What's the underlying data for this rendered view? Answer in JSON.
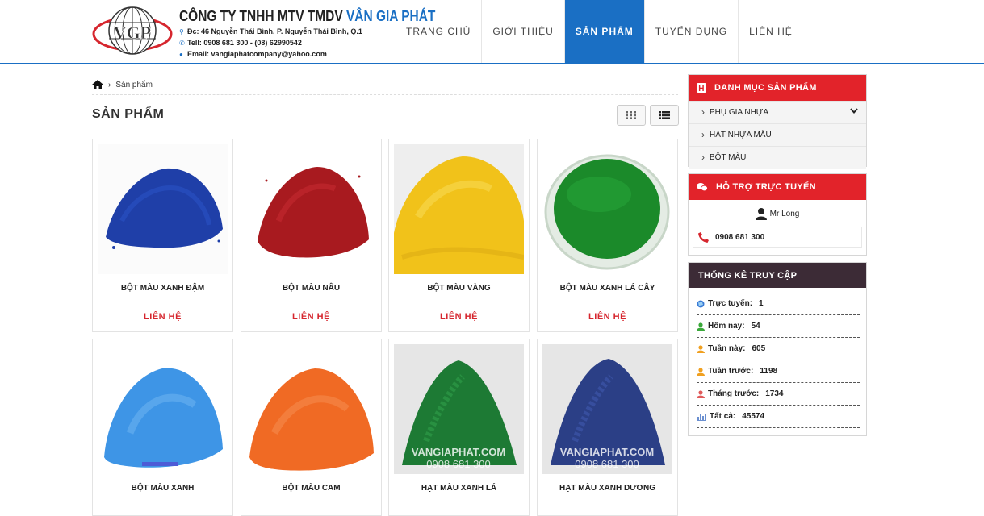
{
  "company": {
    "name_prefix": "CÔNG TY TNHH MTV TMDV ",
    "name_brand": "VÂN GIA PHÁT",
    "address": "Đc: 46 Nguyễn Thái Bình, P. Nguyễn Thái Bình, Q.1",
    "tel": "Tell: 0908 681 300 - (08) 62990542",
    "email": "Email: vangiaphatcompany@yahoo.com",
    "logo_text": "VGP"
  },
  "nav": {
    "items": [
      {
        "label": "TRANG CHỦ"
      },
      {
        "label": "GIỚI THIỆU"
      },
      {
        "label": "SẢN PHẨM"
      },
      {
        "label": "TUYỂN DỤNG"
      },
      {
        "label": "LIÊN HỆ"
      }
    ],
    "active": "SẢN PHẨM"
  },
  "breadcrumb": {
    "current": "Sản phẩm"
  },
  "page_title": "SẢN PHẨM",
  "products": [
    {
      "title": "BỘT MÀU XANH ĐẬM",
      "cta": "LIÊN HỆ",
      "color": "#1f3fa8"
    },
    {
      "title": "BỘT MÀU NÂU",
      "cta": "LIÊN HỆ",
      "color": "#a81a1f"
    },
    {
      "title": "BỘT MÀU VÀNG",
      "cta": "LIÊN HỆ",
      "color": "#f1c21a"
    },
    {
      "title": "BỘT MÀU XANH LÁ CÂY",
      "cta": "LIÊN HỆ",
      "color": "#1b8a2a"
    },
    {
      "title": "BỘT MÀU XANH",
      "color": "#3e95e6"
    },
    {
      "title": "BỘT MÀU CAM",
      "color": "#f06a24"
    },
    {
      "title": "HẠT MÀU XANH LÁ",
      "color": "#1d7a34",
      "watermark": "VANGIAPHAT.COM",
      "watermark_phone": "0908 681 300"
    },
    {
      "title": "HẠT MÀU XANH DƯƠNG",
      "color": "#2b3f86",
      "watermark": "VANGIAPHAT.COM",
      "watermark_phone": "0908 681 300"
    }
  ],
  "sidebar": {
    "categories": {
      "title": "DANH MỤC SẢN PHẨM",
      "items": [
        "PHỤ GIA NHỰA",
        "HẠT NHỰA MÀU",
        "BỘT MÀU"
      ]
    },
    "support": {
      "title": "HỖ TRỢ TRỰC TUYẾN",
      "name": "Mr Long",
      "phone": "0908 681 300"
    },
    "stats": {
      "title": "THỐNG KÊ TRUY CẬP",
      "rows": [
        {
          "label": "Trực tuyến:",
          "value": "1",
          "icon": "globe-icon"
        },
        {
          "label": "Hôm nay:",
          "value": "54",
          "icon": "user-icon"
        },
        {
          "label": "Tuần này:",
          "value": "605",
          "icon": "user-icon"
        },
        {
          "label": "Tuần trước:",
          "value": "1198",
          "icon": "user-icon"
        },
        {
          "label": "Tháng trước:",
          "value": "1734",
          "icon": "user-icon"
        },
        {
          "label": "Tất cả:",
          "value": "45574",
          "icon": "chart-icon"
        }
      ]
    }
  },
  "colors": {
    "primary": "#1a6fc4",
    "accent_red": "#e2232a",
    "dark_head": "#3c2b36"
  }
}
